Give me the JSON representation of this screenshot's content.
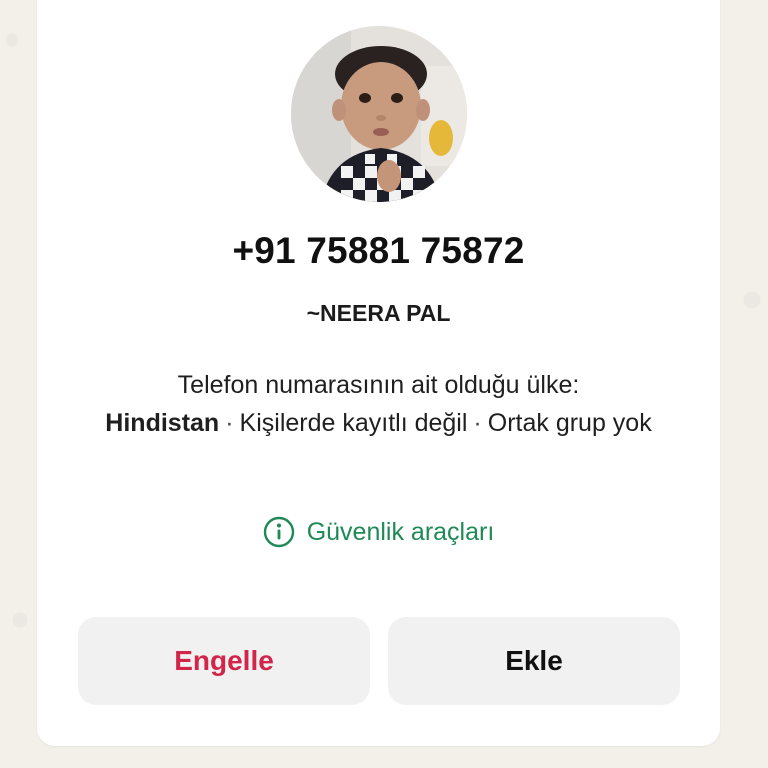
{
  "contact": {
    "phone": "+91 75881 75872",
    "name": "~NEERA PAL"
  },
  "info": {
    "line1": "Telefon numarasının ait olduğu ülke:",
    "country": "Hindistan",
    "separator": "·",
    "not_saved": "Kişilerde kayıtlı değil",
    "no_groups": "Ortak grup yok"
  },
  "safety": {
    "label": "Güvenlik araçları",
    "icon": "info-circle-icon",
    "color": "#1f8a56"
  },
  "actions": {
    "block_label": "Engelle",
    "add_label": "Ekle",
    "block_color": "#d1254a"
  }
}
